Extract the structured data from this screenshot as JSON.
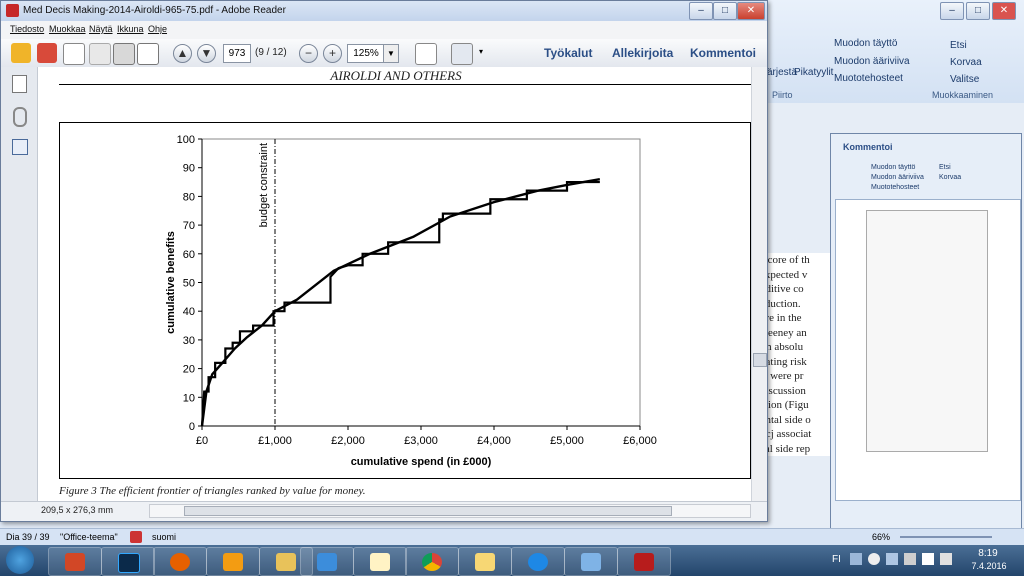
{
  "reader": {
    "title": "Med Decis Making-2014-Airoldi-965-75.pdf - Adobe Reader",
    "menu": [
      "Tiedosto",
      "Muokkaa",
      "Näytä",
      "Ikkuna",
      "Ohje"
    ],
    "page_number": "973",
    "page_count": "(9 / 12)",
    "zoom": "125%",
    "links": [
      "Työkalut",
      "Allekirjoita",
      "Kommentoi"
    ],
    "page_size": "209,5 x 276,3 mm"
  },
  "page": {
    "header": "AIROLDI AND OTHERS",
    "caption": "Figure 3    The efficient frontier of triangles ranked by value for money."
  },
  "chart_data": {
    "type": "line",
    "xlabel": "cumulative spend  (in £000)",
    "ylabel": "cumulative benefits",
    "x_ticks": [
      "£0",
      "£1,000",
      "£2,000",
      "£3,000",
      "£4,000",
      "£5,000",
      "£6,000"
    ],
    "y_ticks": [
      "0",
      "10",
      "20",
      "30",
      "40",
      "50",
      "60",
      "70",
      "80",
      "90",
      "100"
    ],
    "xlim": [
      0,
      6000
    ],
    "ylim": [
      0,
      100
    ],
    "annotation": "budget constraint",
    "budget_x": 1000,
    "frontier": [
      [
        0,
        0
      ],
      [
        60,
        12
      ],
      [
        140,
        18
      ],
      [
        280,
        22
      ],
      [
        450,
        27
      ],
      [
        620,
        31
      ],
      [
        820,
        35
      ],
      [
        1000,
        40
      ],
      [
        1300,
        44
      ],
      [
        1800,
        54
      ],
      [
        2300,
        60
      ],
      [
        2900,
        66
      ],
      [
        3400,
        73
      ],
      [
        4000,
        78
      ],
      [
        4600,
        82
      ],
      [
        5000,
        84
      ],
      [
        5450,
        86
      ]
    ],
    "steps": [
      [
        0,
        0
      ],
      [
        30,
        12
      ],
      [
        90,
        12
      ],
      [
        90,
        17
      ],
      [
        180,
        17
      ],
      [
        180,
        22
      ],
      [
        320,
        22
      ],
      [
        320,
        27
      ],
      [
        420,
        27
      ],
      [
        420,
        29
      ],
      [
        520,
        29
      ],
      [
        520,
        33
      ],
      [
        700,
        33
      ],
      [
        700,
        35
      ],
      [
        980,
        35
      ],
      [
        980,
        40
      ],
      [
        1130,
        40
      ],
      [
        1130,
        43
      ],
      [
        1760,
        43
      ],
      [
        1760,
        52
      ],
      [
        1870,
        55
      ],
      [
        2000,
        56
      ],
      [
        2200,
        56
      ],
      [
        2200,
        60
      ],
      [
        2550,
        60
      ],
      [
        2550,
        64
      ],
      [
        3250,
        64
      ],
      [
        3250,
        72
      ],
      [
        3300,
        72
      ],
      [
        3300,
        74
      ],
      [
        3950,
        74
      ],
      [
        3950,
        79
      ],
      [
        4450,
        79
      ],
      [
        4450,
        82
      ],
      [
        5000,
        82
      ],
      [
        5000,
        85
      ],
      [
        5450,
        85
      ]
    ]
  },
  "background": {
    "ribbon_items": [
      "Muodon täyttö",
      "Muodon ääriviiva",
      "Muototehosteet",
      "Etsi",
      "Korvaa",
      "Valitse"
    ],
    "ribbon_groups": [
      "Piirto",
      "Muokkaaminen"
    ],
    "ribbon_small": [
      "Järjestä",
      "Pikatyylit"
    ],
    "comment_label": "Kommentoi",
    "doc_text": [
      "e core of th",
      "expected v",
      "dditive co",
      "eduction.",
      "ure in the",
      "Keeney an",
      "ith absolu",
      "uating risk",
      "ts were pr",
      "discussion",
      "ation (Figu",
      "ontal side o",
      "t cj associat",
      "cal side rep"
    ]
  },
  "office_status": {
    "slide": "Dia 39 / 39",
    "theme": "\"Office-teema\"",
    "language": "suomi",
    "zoom": "66%"
  },
  "taskbar": {
    "lang": "FI",
    "time": "8:19",
    "date": "7.4.2016"
  }
}
